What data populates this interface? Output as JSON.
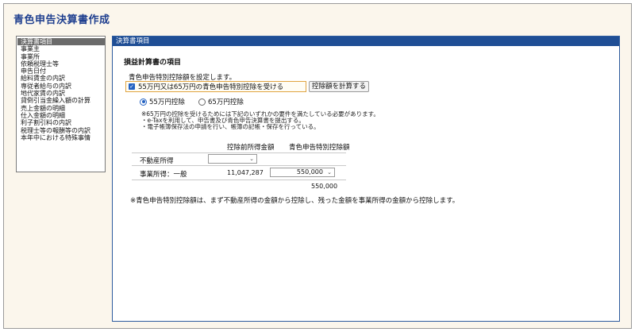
{
  "app": {
    "title": "青色申告決算書作成"
  },
  "sidebar": {
    "items": [
      {
        "label": "決算書項目",
        "selected": true
      },
      {
        "label": "事業主"
      },
      {
        "label": "事業所"
      },
      {
        "label": "依頼税理士等"
      },
      {
        "label": "申告日付"
      },
      {
        "label": "給料賃金の内訳"
      },
      {
        "label": "専従者給与の内訳"
      },
      {
        "label": "地代家賃の内訳"
      },
      {
        "label": "貸倒引当金繰入額の計算"
      },
      {
        "label": "売上金額の明細"
      },
      {
        "label": "仕入金額の明細"
      },
      {
        "label": "利子割引料の内訳"
      },
      {
        "label": "税理士等の報酬等の内訳"
      },
      {
        "label": "本年中における特殊事情"
      }
    ]
  },
  "panel": {
    "header": "決算書項目",
    "section_title": "損益計算書の項目",
    "description": "青色申告特別控除額を設定します。",
    "checkbox_label": "55万円又は65万円の青色申告特別控除を受ける",
    "checkbox_mark": "✓",
    "calc_button": "控除額を計算する",
    "radios": [
      {
        "label": "55万円控除",
        "selected": true
      },
      {
        "label": "65万円控除",
        "selected": false
      }
    ],
    "notes": [
      "※65万円の控除を受けるためには下記のいずれかの要件を満たしている必要があります。",
      "・e-Taxを利用して、申告書及び青色申告決算書を提出する。",
      "・電子帳簿保存法の申請を行い、帳簿の記帳・保存を行っている。"
    ],
    "table": {
      "col1": "控除前所得金額",
      "col2": "青色申告特別控除額",
      "rows": [
        {
          "label": "不動産所得",
          "amount": "",
          "deduction": ""
        },
        {
          "label": "事業所得：一般",
          "amount": "11,047,287",
          "deduction": "550,000"
        }
      ],
      "total": "550,000"
    },
    "bottom_note": "※青色申告特別控除額は、まず不動産所得の金額から控除し、残った金額を事業所得の金額から控除します。"
  },
  "colors": {
    "accent": "#1f4e95",
    "title": "#1f3f8f",
    "background": "#fbf6ec",
    "selected_item": "#6b6b6b"
  }
}
